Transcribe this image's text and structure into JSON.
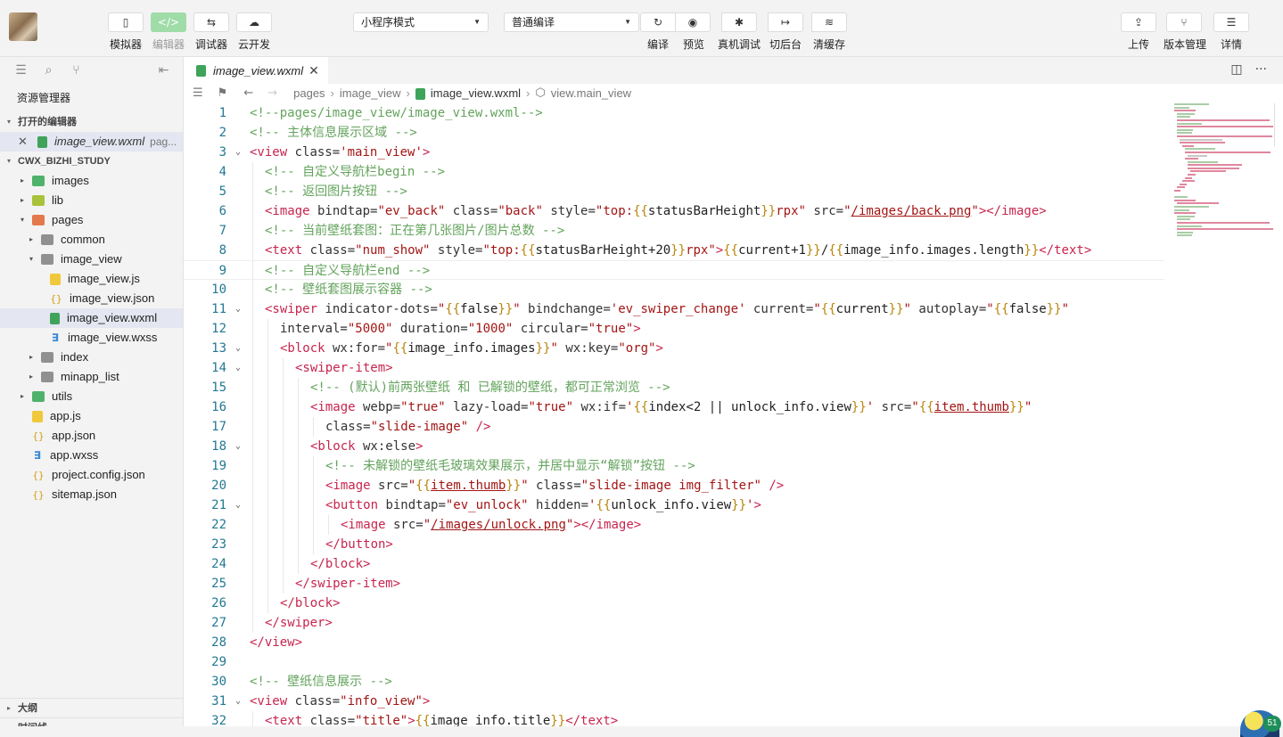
{
  "toolbar": {
    "left_buttons": [
      {
        "name": "simulator",
        "icon": "phone-icon",
        "glyph": "▯",
        "label": "模拟器",
        "active": false
      },
      {
        "name": "editor",
        "icon": "code-icon",
        "glyph": "</>",
        "label": "编辑器",
        "active": true
      },
      {
        "name": "debugger",
        "icon": "debug-icon",
        "glyph": "⇆",
        "label": "调试器",
        "active": false
      },
      {
        "name": "cloud",
        "icon": "cloud-icon",
        "glyph": "☁",
        "label": "云开发",
        "active": false
      }
    ],
    "mode_select": "小程序模式",
    "compile_select": "普通编译",
    "action_group": [
      {
        "name": "compile",
        "icon": "refresh-icon",
        "glyph": "↻",
        "label": "编译"
      },
      {
        "name": "preview",
        "icon": "eye-icon",
        "glyph": "◉",
        "label": "预览"
      },
      {
        "name": "real-device-debug",
        "icon": "bug-icon",
        "glyph": "✱",
        "label": "真机调试"
      },
      {
        "name": "background",
        "icon": "switch-icon",
        "glyph": "↦",
        "label": "切后台"
      },
      {
        "name": "clear-cache",
        "icon": "layers-icon",
        "glyph": "≋",
        "label": "清缓存"
      }
    ],
    "right_buttons": [
      {
        "name": "upload",
        "icon": "upload-icon",
        "glyph": "⇪",
        "label": "上传"
      },
      {
        "name": "version",
        "icon": "branch-icon",
        "glyph": "⑂",
        "label": "版本管理"
      },
      {
        "name": "details",
        "icon": "menu-icon",
        "glyph": "☰",
        "label": "详情"
      }
    ]
  },
  "sidebar": {
    "title": "资源管理器",
    "open_editors_header": "打开的编辑器",
    "open_editor": {
      "file": "image_view.wxml",
      "path": "pag..."
    },
    "project_header": "CWX_BIZHI_STUDY",
    "tree": [
      {
        "label": "images",
        "type": "folder-green",
        "depth": 0,
        "twisty": "▸"
      },
      {
        "label": "lib",
        "type": "folder-lime",
        "depth": 0,
        "twisty": "▸"
      },
      {
        "label": "pages",
        "type": "folder-orange",
        "depth": 0,
        "twisty": "▾"
      },
      {
        "label": "common",
        "type": "folder-gray",
        "depth": 1,
        "twisty": "▸"
      },
      {
        "label": "image_view",
        "type": "folder-gray",
        "depth": 1,
        "twisty": "▾"
      },
      {
        "label": "image_view.js",
        "type": "js",
        "depth": 2,
        "twisty": ""
      },
      {
        "label": "image_view.json",
        "type": "json",
        "depth": 2,
        "twisty": ""
      },
      {
        "label": "image_view.wxml",
        "type": "wxml",
        "depth": 2,
        "twisty": "",
        "selected": true
      },
      {
        "label": "image_view.wxss",
        "type": "wxss",
        "depth": 2,
        "twisty": ""
      },
      {
        "label": "index",
        "type": "folder-gray",
        "depth": 1,
        "twisty": "▸"
      },
      {
        "label": "minapp_list",
        "type": "folder-gray",
        "depth": 1,
        "twisty": "▸"
      },
      {
        "label": "utils",
        "type": "folder-green",
        "depth": 0,
        "twisty": "▸"
      },
      {
        "label": "app.js",
        "type": "js",
        "depth": 0,
        "twisty": ""
      },
      {
        "label": "app.json",
        "type": "json",
        "depth": 0,
        "twisty": ""
      },
      {
        "label": "app.wxss",
        "type": "wxss",
        "depth": 0,
        "twisty": ""
      },
      {
        "label": "project.config.json",
        "type": "json",
        "depth": 0,
        "twisty": ""
      },
      {
        "label": "sitemap.json",
        "type": "json",
        "depth": 0,
        "twisty": ""
      }
    ],
    "outline_header": "大纲",
    "timeline_header": "时间线"
  },
  "editor": {
    "tab_label": "image_view.wxml",
    "breadcrumb": [
      "pages",
      "image_view",
      "image_view.wxml",
      "view.main_view"
    ],
    "lines": [
      {
        "n": "1",
        "fold": "",
        "indent": 0,
        "tokens": [
          [
            "cm",
            "<!--pages/image_view/image_view.wxml-->"
          ]
        ]
      },
      {
        "n": "2",
        "fold": "",
        "indent": 0,
        "tokens": [
          [
            "cm",
            "<!-- 主体信息展示区域 -->"
          ]
        ]
      },
      {
        "n": "3",
        "fold": "⌄",
        "indent": 0,
        "tokens": [
          [
            "tg",
            "<view"
          ],
          [
            "at",
            " class="
          ],
          [
            "st",
            "'main_view'"
          ],
          [
            "tg",
            ">"
          ]
        ]
      },
      {
        "n": "4",
        "fold": "",
        "indent": 1,
        "tokens": [
          [
            "cm",
            "<!-- 自定义导航栏begin -->"
          ]
        ]
      },
      {
        "n": "5",
        "fold": "",
        "indent": 1,
        "tokens": [
          [
            "cm",
            "<!-- 返回图片按钮 -->"
          ]
        ]
      },
      {
        "n": "6",
        "fold": "",
        "indent": 1,
        "tokens": [
          [
            "tg",
            "<image"
          ],
          [
            "at",
            " bindtap="
          ],
          [
            "st",
            "\"ev_back\""
          ],
          [
            "at",
            " class="
          ],
          [
            "st",
            "\"back\""
          ],
          [
            "at",
            " style="
          ],
          [
            "st",
            "\"top:"
          ],
          [
            "br",
            "{{"
          ],
          [
            "tx",
            "statusBarHeight"
          ],
          [
            "br",
            "}}"
          ],
          [
            "st",
            "rpx\""
          ],
          [
            "at",
            " src="
          ],
          [
            "st",
            "\""
          ],
          [
            "un",
            "/images/back.png"
          ],
          [
            "st",
            "\""
          ],
          [
            "tg",
            "></image>"
          ]
        ]
      },
      {
        "n": "7",
        "fold": "",
        "indent": 1,
        "tokens": [
          [
            "cm",
            "<!-- 当前壁纸套图：正在第几张图片/图片总数 -->"
          ]
        ]
      },
      {
        "n": "8",
        "fold": "",
        "indent": 1,
        "tokens": [
          [
            "tg",
            "<text"
          ],
          [
            "at",
            " class="
          ],
          [
            "st",
            "\"num_show\""
          ],
          [
            "at",
            " style="
          ],
          [
            "st",
            "\"top:"
          ],
          [
            "br",
            "{{"
          ],
          [
            "tx",
            "statusBarHeight+20"
          ],
          [
            "br",
            "}}"
          ],
          [
            "st",
            "rpx\""
          ],
          [
            "tg",
            ">"
          ],
          [
            "br",
            "{{"
          ],
          [
            "tx",
            "current+1"
          ],
          [
            "br",
            "}}"
          ],
          [
            "tx",
            "/"
          ],
          [
            "br",
            "{{"
          ],
          [
            "tx",
            "image_info.images.length"
          ],
          [
            "br",
            "}}"
          ],
          [
            "tg",
            "</text>"
          ]
        ]
      },
      {
        "n": "9",
        "fold": "",
        "indent": 1,
        "cur": true,
        "tokens": [
          [
            "cm",
            "<!-- 自定义导航栏end -->"
          ]
        ]
      },
      {
        "n": "10",
        "fold": "",
        "indent": 1,
        "tokens": [
          [
            "cm",
            "<!-- 壁纸套图展示容器 -->"
          ]
        ]
      },
      {
        "n": "11",
        "fold": "⌄",
        "indent": 1,
        "tokens": [
          [
            "tg",
            "<swiper"
          ],
          [
            "at",
            " indicator-dots="
          ],
          [
            "st",
            "\""
          ],
          [
            "br",
            "{{"
          ],
          [
            "tx",
            "false"
          ],
          [
            "br",
            "}}"
          ],
          [
            "st",
            "\""
          ],
          [
            "at",
            " bindchange="
          ],
          [
            "st",
            "'ev_swiper_change'"
          ],
          [
            "at",
            " current="
          ],
          [
            "st",
            "\""
          ],
          [
            "br",
            "{{"
          ],
          [
            "tx",
            "current"
          ],
          [
            "br",
            "}}"
          ],
          [
            "st",
            "\""
          ],
          [
            "at",
            " autoplay="
          ],
          [
            "st",
            "\""
          ],
          [
            "br",
            "{{"
          ],
          [
            "tx",
            "false"
          ],
          [
            "br",
            "}}"
          ],
          [
            "st",
            "\""
          ]
        ]
      },
      {
        "n": "12",
        "fold": "",
        "indent": 2,
        "tokens": [
          [
            "at",
            "interval="
          ],
          [
            "st",
            "\"5000\""
          ],
          [
            "at",
            " duration="
          ],
          [
            "st",
            "\"1000\""
          ],
          [
            "at",
            " circular="
          ],
          [
            "st",
            "\"true\""
          ],
          [
            "tg",
            ">"
          ]
        ]
      },
      {
        "n": "13",
        "fold": "⌄",
        "indent": 2,
        "tokens": [
          [
            "tg",
            "<block"
          ],
          [
            "at",
            " wx:for="
          ],
          [
            "st",
            "\""
          ],
          [
            "br",
            "{{"
          ],
          [
            "tx",
            "image_info.images"
          ],
          [
            "br",
            "}}"
          ],
          [
            "st",
            "\""
          ],
          [
            "at",
            " wx:key="
          ],
          [
            "st",
            "\"org\""
          ],
          [
            "tg",
            ">"
          ]
        ]
      },
      {
        "n": "14",
        "fold": "⌄",
        "indent": 3,
        "tokens": [
          [
            "tg",
            "<swiper-item>"
          ]
        ]
      },
      {
        "n": "15",
        "fold": "",
        "indent": 4,
        "tokens": [
          [
            "cm",
            "<!-- (默认)前两张壁纸 和 已解锁的壁纸，都可正常浏览 -->"
          ]
        ]
      },
      {
        "n": "16",
        "fold": "",
        "indent": 4,
        "tokens": [
          [
            "tg",
            "<image"
          ],
          [
            "at",
            " webp="
          ],
          [
            "st",
            "\"true\""
          ],
          [
            "at",
            " lazy-load="
          ],
          [
            "st",
            "\"true\""
          ],
          [
            "at",
            " wx:if="
          ],
          [
            "st",
            "'"
          ],
          [
            "br",
            "{{"
          ],
          [
            "tx",
            "index<2 || unlock_info.view"
          ],
          [
            "br",
            "}}"
          ],
          [
            "st",
            "'"
          ],
          [
            "at",
            " src="
          ],
          [
            "st",
            "\""
          ],
          [
            "br",
            "{{"
          ],
          [
            "un",
            "item.thumb"
          ],
          [
            "br",
            "}}"
          ],
          [
            "st",
            "\""
          ]
        ]
      },
      {
        "n": "17",
        "fold": "",
        "indent": 5,
        "tokens": [
          [
            "at",
            "class="
          ],
          [
            "st",
            "\"slide-image\""
          ],
          [
            "tg",
            " />"
          ]
        ]
      },
      {
        "n": "18",
        "fold": "⌄",
        "indent": 4,
        "tokens": [
          [
            "tg",
            "<block"
          ],
          [
            "at",
            " wx:else"
          ],
          [
            "tg",
            ">"
          ]
        ]
      },
      {
        "n": "19",
        "fold": "",
        "indent": 5,
        "tokens": [
          [
            "cm",
            "<!-- 未解锁的壁纸毛玻璃效果展示，并居中显示“解锁”按钮 -->"
          ]
        ]
      },
      {
        "n": "20",
        "fold": "",
        "indent": 5,
        "tokens": [
          [
            "tg",
            "<image"
          ],
          [
            "at",
            " src="
          ],
          [
            "st",
            "\""
          ],
          [
            "br",
            "{{"
          ],
          [
            "un",
            "item.thumb"
          ],
          [
            "br",
            "}}"
          ],
          [
            "st",
            "\""
          ],
          [
            "at",
            " class="
          ],
          [
            "st",
            "\"slide-image img_filter\""
          ],
          [
            "tg",
            " />"
          ]
        ]
      },
      {
        "n": "21",
        "fold": "⌄",
        "indent": 5,
        "tokens": [
          [
            "tg",
            "<button"
          ],
          [
            "at",
            " bindtap="
          ],
          [
            "st",
            "\"ev_unlock\""
          ],
          [
            "at",
            " hidden="
          ],
          [
            "st",
            "'"
          ],
          [
            "br",
            "{{"
          ],
          [
            "tx",
            "unlock_info.view"
          ],
          [
            "br",
            "}}"
          ],
          [
            "st",
            "'"
          ],
          [
            "tg",
            ">"
          ]
        ]
      },
      {
        "n": "22",
        "fold": "",
        "indent": 6,
        "tokens": [
          [
            "tg",
            "<image"
          ],
          [
            "at",
            " src="
          ],
          [
            "st",
            "\""
          ],
          [
            "un",
            "/images/unlock.png"
          ],
          [
            "st",
            "\""
          ],
          [
            "tg",
            "></image>"
          ]
        ]
      },
      {
        "n": "23",
        "fold": "",
        "indent": 5,
        "tokens": [
          [
            "tg",
            "</button>"
          ]
        ]
      },
      {
        "n": "24",
        "fold": "",
        "indent": 4,
        "tokens": [
          [
            "tg",
            "</block>"
          ]
        ]
      },
      {
        "n": "25",
        "fold": "",
        "indent": 3,
        "tokens": [
          [
            "tg",
            "</swiper-item>"
          ]
        ]
      },
      {
        "n": "26",
        "fold": "",
        "indent": 2,
        "tokens": [
          [
            "tg",
            "</block>"
          ]
        ]
      },
      {
        "n": "27",
        "fold": "",
        "indent": 1,
        "tokens": [
          [
            "tg",
            "</swiper>"
          ]
        ]
      },
      {
        "n": "28",
        "fold": "",
        "indent": 0,
        "tokens": [
          [
            "tg",
            "</view>"
          ]
        ]
      },
      {
        "n": "29",
        "fold": "",
        "indent": 0,
        "tokens": []
      },
      {
        "n": "30",
        "fold": "",
        "indent": 0,
        "tokens": [
          [
            "cm",
            "<!-- 壁纸信息展示 -->"
          ]
        ]
      },
      {
        "n": "31",
        "fold": "⌄",
        "indent": 0,
        "tokens": [
          [
            "tg",
            "<view"
          ],
          [
            "at",
            " class="
          ],
          [
            "st",
            "\"info_view\""
          ],
          [
            "tg",
            ">"
          ]
        ]
      },
      {
        "n": "32",
        "fold": "",
        "indent": 1,
        "tokens": [
          [
            "tg",
            "<text"
          ],
          [
            "at",
            " class="
          ],
          [
            "st",
            "\"title\""
          ],
          [
            "tg",
            ">"
          ],
          [
            "br",
            "{{"
          ],
          [
            "tx",
            "image_info.title"
          ],
          [
            "br",
            "}}"
          ],
          [
            "tg",
            "</text>"
          ]
        ]
      }
    ]
  },
  "colors": {
    "comment": "#63a35c",
    "tag": "#c7254e",
    "string": "#a31515",
    "line_number": "#237893",
    "active_button": "#9fdca8"
  },
  "status_badge": "51"
}
